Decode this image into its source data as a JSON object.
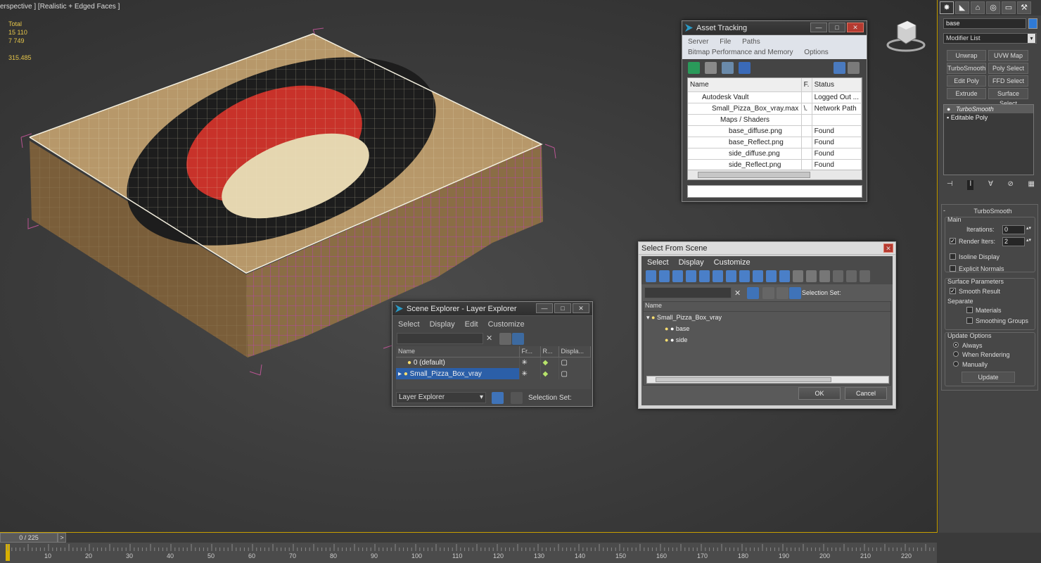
{
  "viewport": {
    "label": "erspective ] [Realistic + Edged Faces ]",
    "stats": {
      "total_label": "Total",
      "polys": "15 110",
      "verts": "7 749",
      "fps": "315.485"
    }
  },
  "asset_tracking": {
    "title": "Asset Tracking",
    "menus_row1": [
      "Server",
      "File",
      "Paths"
    ],
    "menus_row2": [
      "Bitmap Performance and Memory",
      "Options"
    ],
    "columns": [
      "Name",
      "F.",
      "Status"
    ],
    "rows": [
      {
        "name": "Autodesk Vault",
        "f": "",
        "status": "Logged Out ..."
      },
      {
        "name": "Small_Pizza_Box_vray.max",
        "f": "\\.",
        "status": "Network Path"
      },
      {
        "name": "Maps / Shaders",
        "f": "",
        "status": ""
      },
      {
        "name": "base_diffuse.png",
        "f": "",
        "status": "Found"
      },
      {
        "name": "base_Reflect.png",
        "f": "",
        "status": "Found"
      },
      {
        "name": "side_diffuse.png",
        "f": "",
        "status": "Found"
      },
      {
        "name": "side_Reflect.png",
        "f": "",
        "status": "Found"
      }
    ]
  },
  "scene_explorer": {
    "title": "Scene Explorer - Layer Explorer",
    "menus": [
      "Select",
      "Display",
      "Edit",
      "Customize"
    ],
    "columns": [
      "Name",
      "Fr...",
      "R...",
      "Displa..."
    ],
    "rows": [
      {
        "name": "0 (default)",
        "selected": false
      },
      {
        "name": "Small_Pizza_Box_vray",
        "selected": true
      }
    ],
    "explorer_combo": "Layer Explorer",
    "selection_set_label": "Selection Set:"
  },
  "select_from_scene": {
    "title": "Select From Scene",
    "menus": [
      "Select",
      "Display",
      "Customize"
    ],
    "selection_set_label": "Selection Set:",
    "column": "Name",
    "tree": [
      "Small_Pizza_Box_vray",
      "base",
      "side"
    ],
    "ok": "OK",
    "cancel": "Cancel"
  },
  "command_panel": {
    "name_field": "base",
    "modifier_list": "Modifier List",
    "modifier_buttons": [
      "Unwrap UVW",
      "UVW Map",
      "TurboSmooth",
      "Poly Select",
      "Edit Poly",
      "FFD Select",
      "Extrude",
      "Surface Select"
    ],
    "stack": [
      "TurboSmooth",
      "Editable Poly"
    ],
    "rollout_title": "TurboSmooth",
    "main_label": "Main",
    "iterations_label": "Iterations:",
    "iterations_value": "0",
    "render_iters_label": "Render Iters:",
    "render_iters_value": "2",
    "isoline_label": "Isoline Display",
    "explicit_normals_label": "Explicit Normals",
    "surface_params_label": "Surface Parameters",
    "smooth_result_label": "Smooth Result",
    "separate_label": "Separate",
    "materials_label": "Materials",
    "smoothing_groups_label": "Smoothing Groups",
    "update_options_label": "Update Options",
    "update_always": "Always",
    "update_rendering": "When Rendering",
    "update_manually": "Manually",
    "update_button": "Update"
  },
  "timeline": {
    "frame_readout": "0 / 225",
    "next_label": ">",
    "ticks": [
      "10",
      "20",
      "30",
      "40",
      "50",
      "60",
      "70",
      "80",
      "90",
      "100",
      "110",
      "120",
      "130",
      "140",
      "150",
      "160",
      "170",
      "180",
      "190",
      "200",
      "210",
      "220"
    ]
  }
}
